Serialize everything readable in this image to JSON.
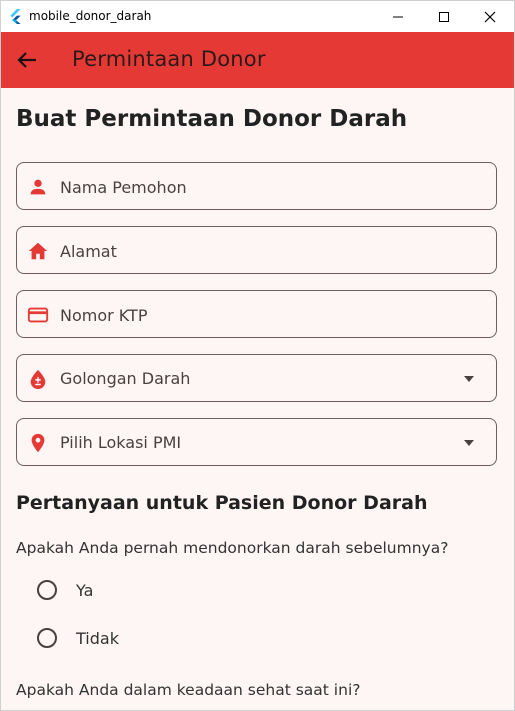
{
  "window": {
    "title": "mobile_donor_darah"
  },
  "appbar": {
    "title": "Permintaan Donor",
    "color": "#e53935"
  },
  "form": {
    "heading": "Buat Permintaan Donor Darah",
    "name_field": {
      "placeholder": "Nama Pemohon",
      "icon": "person-icon"
    },
    "address_field": {
      "placeholder": "Alamat",
      "icon": "home-icon"
    },
    "ktp_field": {
      "placeholder": "Nomor KTP",
      "icon": "credit-card-icon"
    },
    "blood_type_select": {
      "value": "Golongan Darah",
      "icon": "blood-drop-icon"
    },
    "pmi_location_select": {
      "value": "Pilih Lokasi PMI",
      "icon": "location-pin-icon"
    }
  },
  "questions": {
    "section_title": "Pertanyaan untuk Pasien Donor Darah",
    "q1": {
      "text": "Apakah Anda pernah mendonorkan darah sebelumnya?",
      "options": [
        "Ya",
        "Tidak"
      ]
    },
    "q2": {
      "text": "Apakah Anda dalam keadaan sehat saat ini?"
    }
  },
  "colors": {
    "accent": "#e53935",
    "background": "#fef6f5",
    "border": "#6e5e5e"
  }
}
